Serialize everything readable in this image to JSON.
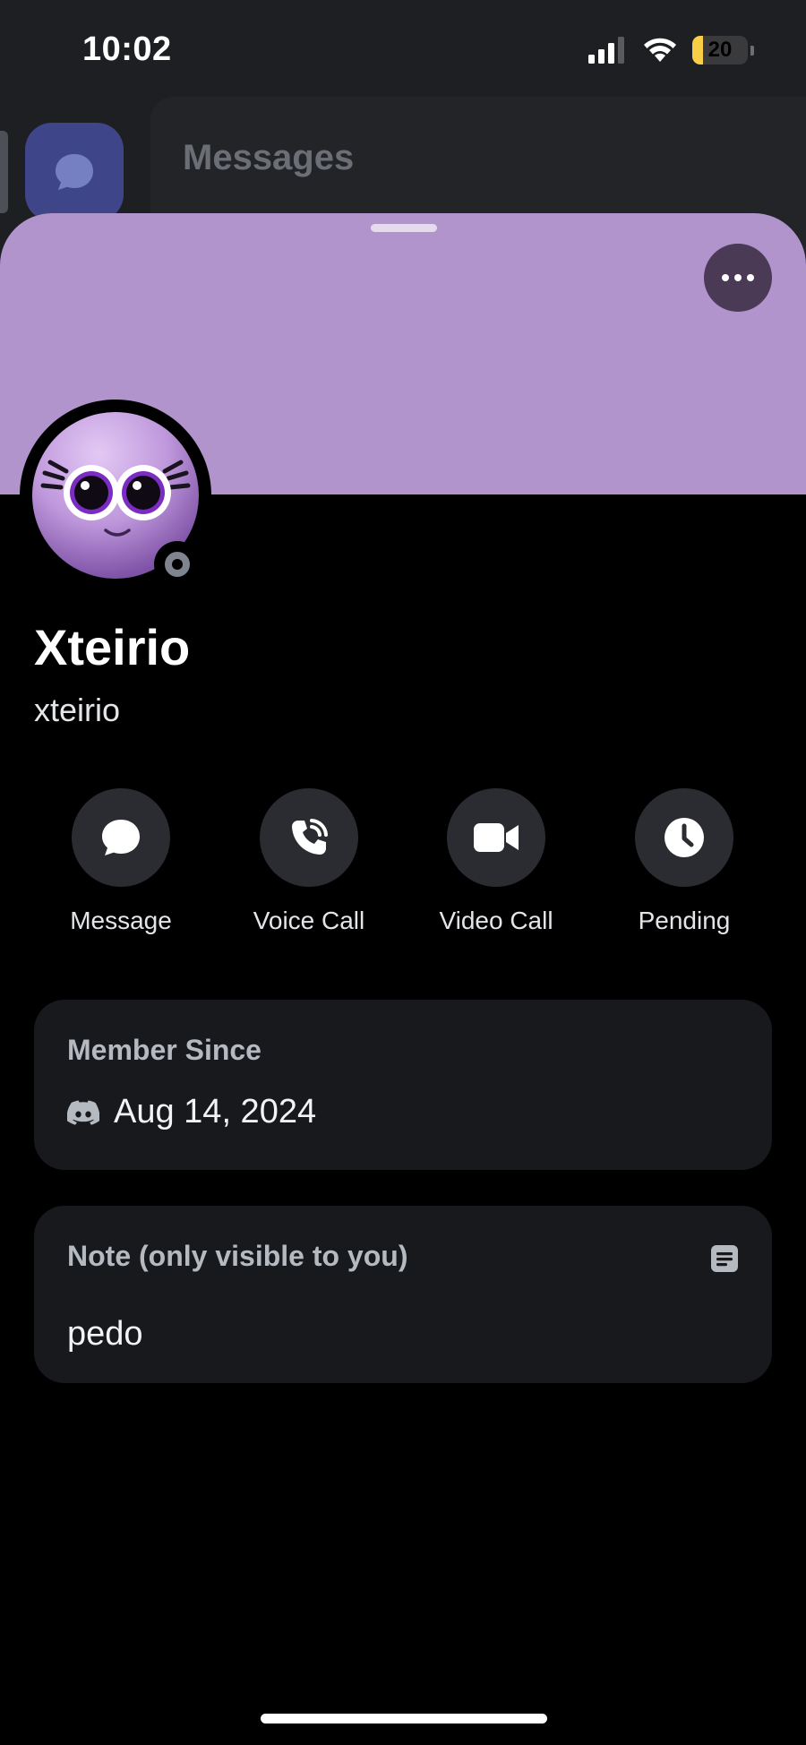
{
  "status_bar": {
    "time": "10:02",
    "battery_level": "20",
    "battery_percent": 20
  },
  "background": {
    "messages_title": "Messages"
  },
  "profile": {
    "banner_color": "#b194cc",
    "display_name": "Xteirio",
    "username": "xteirio",
    "presence": "offline"
  },
  "actions": [
    {
      "label": "Message",
      "icon": "chat-bubble-icon"
    },
    {
      "label": "Voice Call",
      "icon": "phone-call-icon"
    },
    {
      "label": "Video Call",
      "icon": "video-camera-icon"
    },
    {
      "label": "Pending",
      "icon": "clock-icon"
    }
  ],
  "member_since": {
    "title": "Member Since",
    "icon": "discord-logo-icon",
    "date": "Aug 14, 2024"
  },
  "note": {
    "title": "Note (only visible to you)",
    "icon": "note-icon",
    "text": "pedo"
  }
}
